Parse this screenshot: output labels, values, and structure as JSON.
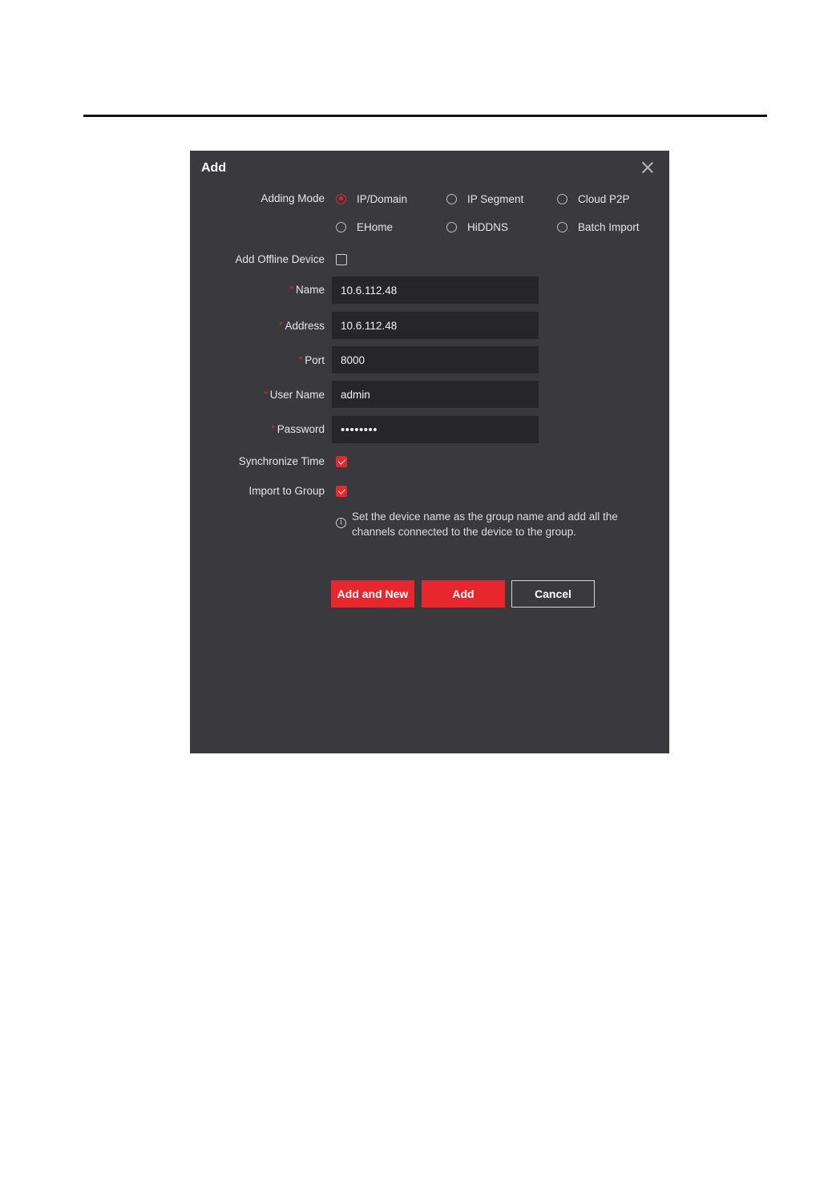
{
  "dialog": {
    "title": "Add",
    "adding_mode": {
      "label": "Adding Mode",
      "options": [
        "IP/Domain",
        "IP Segment",
        "Cloud P2P",
        "EHome",
        "HiDDNS",
        "Batch Import"
      ],
      "selected": "IP/Domain"
    },
    "offline_device": {
      "label": "Add Offline Device",
      "checked": false
    },
    "required_mark": "*",
    "fields": {
      "name": {
        "label": "Name",
        "value": "10.6.112.48"
      },
      "address": {
        "label": "Address",
        "value": "10.6.112.48"
      },
      "port": {
        "label": "Port",
        "value": "8000"
      },
      "user_name": {
        "label": "User Name",
        "value": "admin"
      },
      "password": {
        "label": "Password",
        "value": "••••••••"
      }
    },
    "synchronize_time": {
      "label": "Synchronize Time",
      "checked": true
    },
    "import_to_group": {
      "label": "Import to Group",
      "checked": true
    },
    "hint": "Set the device name as the group name and add all the channels connected to the device to the group.",
    "buttons": {
      "add_and_new": "Add and New",
      "add": "Add",
      "cancel": "Cancel"
    }
  },
  "colors": {
    "dialog_bg": "#3a3a3e",
    "input_bg": "#26262a",
    "accent": "#e8262d"
  }
}
